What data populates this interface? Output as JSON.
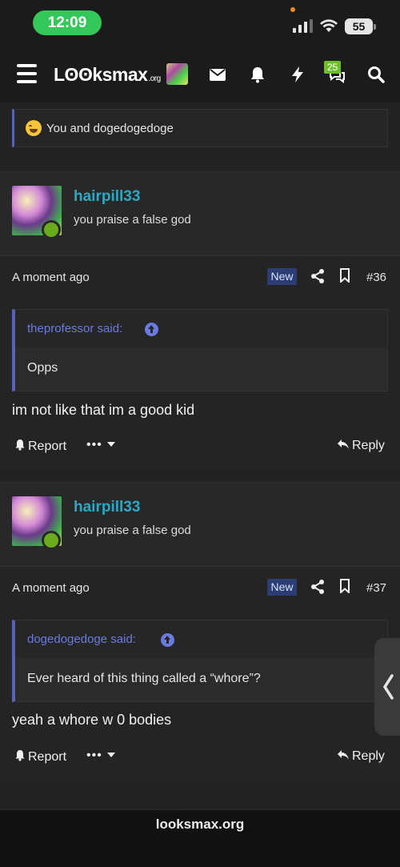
{
  "status_bar": {
    "time": "12:09",
    "battery": "55"
  },
  "nav": {
    "logo_text": "Lʘʘksmax",
    "logo_suffix": ".org",
    "notification_badge": "25",
    "icons": [
      "menu-icon",
      "avatar",
      "envelope-icon",
      "bell-icon",
      "bolt-icon",
      "chat-icon",
      "search-icon"
    ]
  },
  "reactions": {
    "text": "You and dogedogedoge"
  },
  "posts": [
    {
      "username": "hairpill33",
      "user_title": "you praise a false god",
      "time": "A moment ago",
      "badge": "New",
      "post_number": "#36",
      "quote_author": "theprofessor said:",
      "quote_text": "Opps",
      "body": "im not like that im a good kid",
      "actions": {
        "report": "Report",
        "more": "•••",
        "reply": "Reply"
      }
    },
    {
      "username": "hairpill33",
      "user_title": "you praise a false god",
      "time": "A moment ago",
      "badge": "New",
      "post_number": "#37",
      "quote_author": "dogedogedoge said:",
      "quote_text": "Ever heard of this thing called a “whore”?",
      "body": "yeah a whore w 0 bodies",
      "actions": {
        "report": "Report",
        "more": "•••",
        "reply": "Reply"
      }
    }
  ],
  "footer": {
    "url": "looksmax.org"
  },
  "colors": {
    "accent": "#5863b8",
    "username": "#2aa8c7",
    "online": "#6aac1d",
    "badge_bg": "#2b3d72"
  }
}
